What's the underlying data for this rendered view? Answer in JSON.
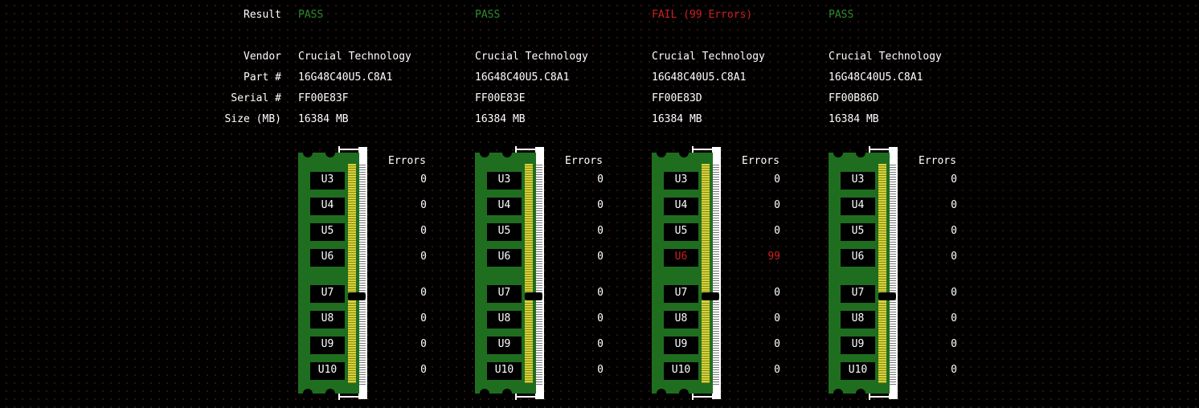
{
  "labels": {
    "result": "Result",
    "vendor": "Vendor",
    "part": "Part #",
    "serial": "Serial #",
    "size": "Size (MB)",
    "errors_header": "Errors"
  },
  "colors": {
    "pass": "#2f8a2f",
    "fail": "#d01f1f",
    "pcb": "#1f6e1f",
    "gold": "#d6d23a"
  },
  "chips": [
    "U3",
    "U4",
    "U5",
    "U6",
    "U7",
    "U8",
    "U9",
    "U10"
  ],
  "modules": [
    {
      "result": "PASS",
      "status": "pass",
      "vendor": "Crucial Technology",
      "part": "16G48C40U5.C8A1",
      "serial": "FF00E83F",
      "size": "16384 MB",
      "errors": [
        "0",
        "0",
        "0",
        "0",
        "0",
        "0",
        "0",
        "0"
      ],
      "bad_chips": []
    },
    {
      "result": "PASS",
      "status": "pass",
      "vendor": "Crucial Technology",
      "part": "16G48C40U5.C8A1",
      "serial": "FF00E83E",
      "size": "16384 MB",
      "errors": [
        "0",
        "0",
        "0",
        "0",
        "0",
        "0",
        "0",
        "0"
      ],
      "bad_chips": []
    },
    {
      "result": "FAIL (99 Errors)",
      "status": "fail",
      "vendor": "Crucial Technology",
      "part": "16G48C40U5.C8A1",
      "serial": "FF00E83D",
      "size": "16384 MB",
      "errors": [
        "0",
        "0",
        "0",
        "99",
        "0",
        "0",
        "0",
        "0"
      ],
      "bad_chips": [
        3
      ]
    },
    {
      "result": "PASS",
      "status": "pass",
      "vendor": "Crucial Technology",
      "part": "16G48C40U5.C8A1",
      "serial": "FF00B86D",
      "size": "16384 MB",
      "errors": [
        "0",
        "0",
        "0",
        "0",
        "0",
        "0",
        "0",
        "0"
      ],
      "bad_chips": []
    }
  ]
}
